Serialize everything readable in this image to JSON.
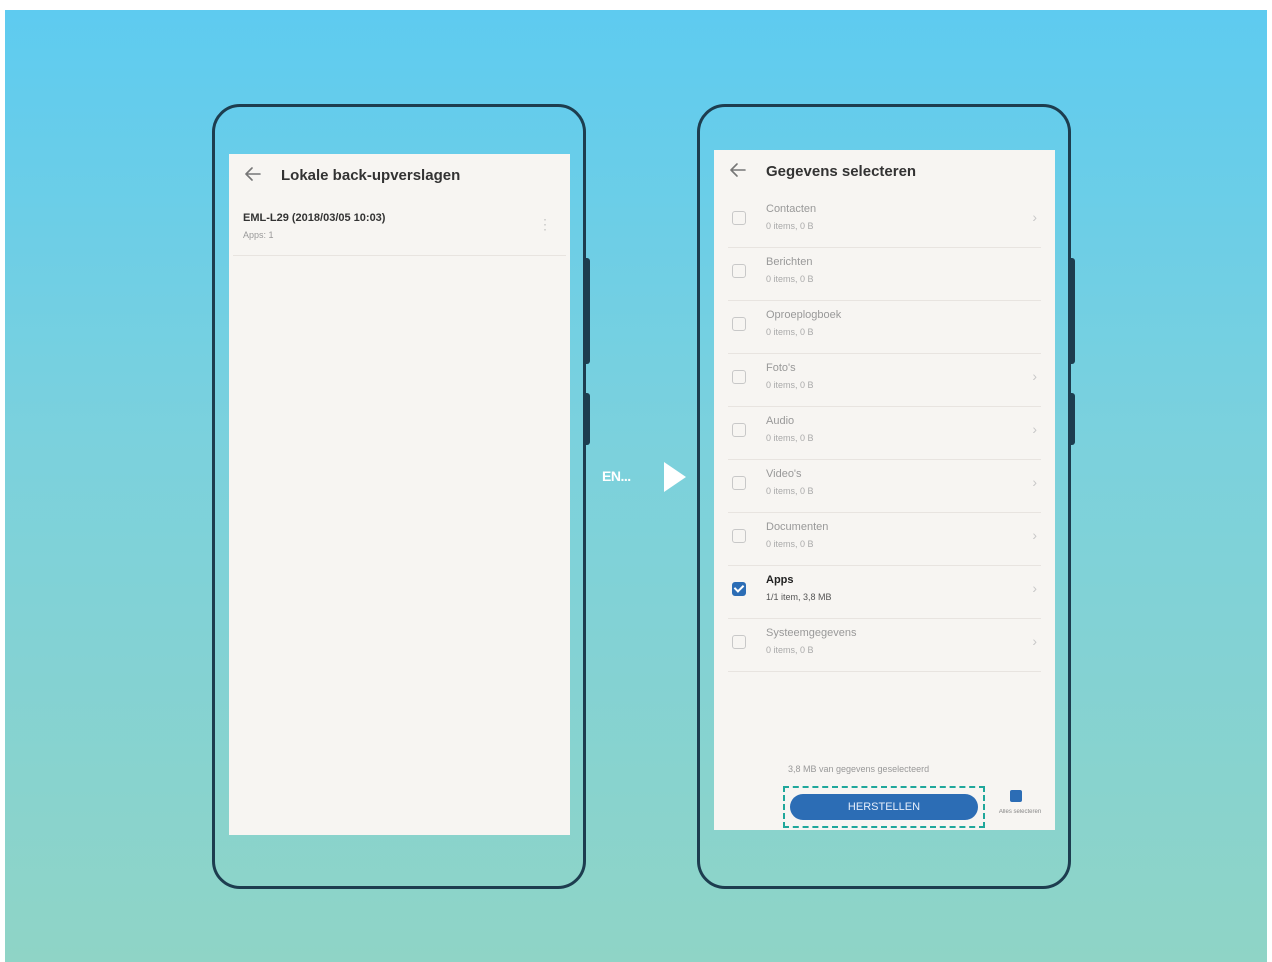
{
  "left_screen": {
    "title": "Lokale back-upverslagen",
    "backup_name": "EML-L29 (2018/03/05 10:03)",
    "backup_detail": "Apps: 1"
  },
  "arrow": {
    "label": "EN..."
  },
  "right_screen": {
    "title": "Gegevens selecteren",
    "items": [
      {
        "name": "Contacten",
        "meta": "0 items, 0 B",
        "checked": false
      },
      {
        "name": "Berichten",
        "meta": "0 items, 0 B",
        "checked": false
      },
      {
        "name": "Oproeplogboek",
        "meta": "0 items, 0 B",
        "checked": false
      },
      {
        "name": "Foto's",
        "meta": "0 items, 0 B",
        "checked": false
      },
      {
        "name": "Audio",
        "meta": "0 items, 0 B",
        "checked": false
      },
      {
        "name": "Video's",
        "meta": "0 items, 0 B",
        "checked": false
      },
      {
        "name": "Documenten",
        "meta": "0 items, 0 B",
        "checked": false
      },
      {
        "name": "Apps",
        "meta": "1/1 item, 3,8 MB",
        "checked": true
      },
      {
        "name": "Systeemgegevens",
        "meta": "0 items, 0 B",
        "checked": false
      }
    ],
    "selected_summary": "3,8 MB van gegevens geselecteerd",
    "restore_button": "HERSTELLEN",
    "secondary_label": "Alles selecteren"
  },
  "colors": {
    "accent": "#2c6db5",
    "highlight": "#1fa79b",
    "phone_outline": "#1d3d4f"
  }
}
